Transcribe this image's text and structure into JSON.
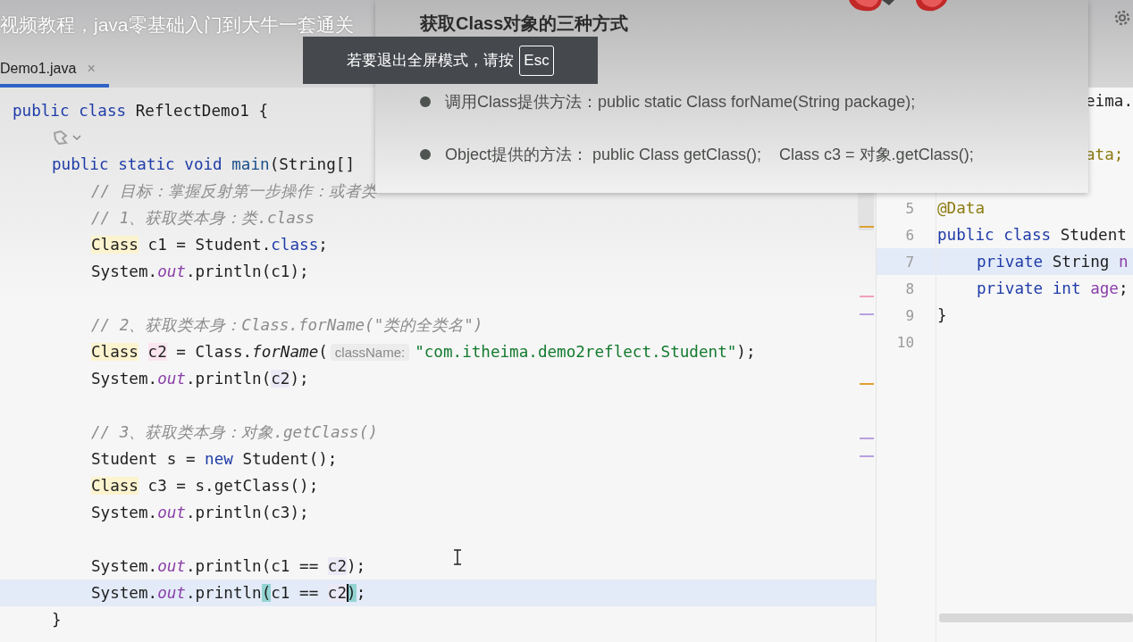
{
  "video_title": "视频教程，java零基础入门到大牛一套通关",
  "tab": {
    "label": "Demo1.java",
    "close": "×",
    "selected": true
  },
  "left_lines": [
    {
      "kind": "top",
      "current": false,
      "tokens": [
        {
          "kind": "kw",
          "text": "public class "
        },
        {
          "kind": "plain",
          "text": "ReflectDemo1 {"
        }
      ]
    },
    {
      "kind": "icon",
      "current": false
    },
    {
      "kind": "member",
      "current": false,
      "tokens": [
        {
          "kind": "kw",
          "text": "public static void "
        },
        {
          "kind": "method",
          "text": "main"
        },
        {
          "kind": "plain",
          "text": "(String[]"
        }
      ]
    },
    {
      "kind": "body",
      "current": false,
      "tokens": [
        {
          "kind": "comment",
          "text": "// 目标：掌握反射第一步操作：或者类"
        }
      ]
    },
    {
      "kind": "body",
      "current": false,
      "tokens": [
        {
          "kind": "comment",
          "text": "// 1、获取类本身：类.class"
        }
      ]
    },
    {
      "kind": "body",
      "current": false,
      "tokens": [
        {
          "kind": "type-hl",
          "text": "Class"
        },
        {
          "kind": "plain",
          "text": " c1 = Student."
        },
        {
          "kind": "kw",
          "text": "class"
        },
        {
          "kind": "plain",
          "text": ";"
        }
      ]
    },
    {
      "kind": "body",
      "current": false,
      "tokens": [
        {
          "kind": "plain",
          "text": "System."
        },
        {
          "kind": "field",
          "text": "out"
        },
        {
          "kind": "plain",
          "text": ".println(c1);"
        }
      ]
    },
    {
      "kind": "blank",
      "current": false
    },
    {
      "kind": "body",
      "current": false,
      "tokens": [
        {
          "kind": "comment",
          "text": "// 2、获取类本身：Class.forName(\"类的全类名\")"
        }
      ]
    },
    {
      "kind": "body",
      "current": false,
      "tokens": [
        {
          "kind": "type-hl",
          "text": "Class"
        },
        {
          "kind": "var-hl",
          "text": "c2"
        },
        {
          "kind": "plain",
          "text": " = Class."
        },
        {
          "kind": "static",
          "text": "forName"
        },
        {
          "kind": "plain",
          "text": "("
        },
        {
          "kind": "hint",
          "text": "className:"
        },
        {
          "kind": "string",
          "text": "\"com.itheima.demo2reflect.Student\""
        },
        {
          "kind": "plain",
          "text": ");"
        }
      ]
    },
    {
      "kind": "body",
      "current": false,
      "tokens": [
        {
          "kind": "plain",
          "text": "System."
        },
        {
          "kind": "field",
          "text": "out"
        },
        {
          "kind": "plain",
          "text": ".println("
        },
        {
          "kind": "ref-hl",
          "text": "c2"
        },
        {
          "kind": "plain",
          "text": ");"
        }
      ]
    },
    {
      "kind": "blank",
      "current": false
    },
    {
      "kind": "body",
      "current": false,
      "tokens": [
        {
          "kind": "comment",
          "text": "// 3、获取类本身：对象.getClass()"
        }
      ]
    },
    {
      "kind": "body",
      "current": false,
      "tokens": [
        {
          "kind": "plain",
          "text": "Student s = "
        },
        {
          "kind": "kw",
          "text": "new"
        },
        {
          "kind": "plain",
          "text": " Student();"
        }
      ]
    },
    {
      "kind": "body",
      "current": false,
      "tokens": [
        {
          "kind": "type-hl",
          "text": "Class"
        },
        {
          "kind": "plain",
          "text": " c3 = s.getClass();"
        }
      ]
    },
    {
      "kind": "body",
      "current": false,
      "tokens": [
        {
          "kind": "plain",
          "text": "System."
        },
        {
          "kind": "field",
          "text": "out"
        },
        {
          "kind": "plain",
          "text": ".println(c3);"
        }
      ]
    },
    {
      "kind": "blank",
      "current": false
    },
    {
      "kind": "body",
      "current": false,
      "tokens": [
        {
          "kind": "plain",
          "text": "System."
        },
        {
          "kind": "field",
          "text": "out"
        },
        {
          "kind": "plain",
          "text": ".println(c1 == "
        },
        {
          "kind": "ref-hl",
          "text": "c2"
        },
        {
          "kind": "plain",
          "text": ");"
        }
      ]
    },
    {
      "kind": "body",
      "current": true,
      "tokens": [
        {
          "kind": "plain",
          "text": "System."
        },
        {
          "kind": "field",
          "text": "out"
        },
        {
          "kind": "plain",
          "text": ".println"
        },
        {
          "kind": "brace-hl",
          "text": "("
        },
        {
          "kind": "plain",
          "text": "c1 == "
        },
        {
          "kind": "ref-hl",
          "text": "c2"
        },
        {
          "kind": "brace-caret",
          "text": ")"
        },
        {
          "kind": "plain",
          "text": ";"
        }
      ]
    },
    {
      "kind": "member",
      "current": false,
      "tokens": [
        {
          "kind": "plain",
          "text": "}"
        }
      ]
    }
  ],
  "right_lines": [
    {
      "kind": "partial",
      "current": false,
      "tokens": [
        {
          "kind": "plain",
          "text": "eima."
        }
      ]
    },
    {
      "kind": "blank",
      "current": false
    },
    {
      "kind": "partial",
      "current": false,
      "tokens": [
        {
          "kind": "annot",
          "text": "ata;"
        }
      ]
    },
    {
      "kind": "blank",
      "current": false
    },
    {
      "kind": "top",
      "number": "5",
      "current": false,
      "tokens": [
        {
          "kind": "annot",
          "text": "@Data"
        }
      ]
    },
    {
      "kind": "top",
      "number": "6",
      "current": false,
      "tokens": [
        {
          "kind": "kw",
          "text": "public class "
        },
        {
          "kind": "plain",
          "text": "Student"
        }
      ]
    },
    {
      "kind": "member",
      "number": "7",
      "current": true,
      "tokens": [
        {
          "kind": "kw",
          "text": "private "
        },
        {
          "kind": "plain",
          "text": "String "
        },
        {
          "kind": "field-plain",
          "text": "n"
        }
      ]
    },
    {
      "kind": "member",
      "number": "8",
      "current": false,
      "tokens": [
        {
          "kind": "kw",
          "text": "private int "
        },
        {
          "kind": "field-plain",
          "text": "age"
        },
        {
          "kind": "plain",
          "text": ";"
        }
      ]
    },
    {
      "kind": "top",
      "number": "9",
      "current": false,
      "tokens": [
        {
          "kind": "plain",
          "text": "}"
        }
      ]
    },
    {
      "kind": "blank",
      "number": "10",
      "current": false
    }
  ],
  "slide": {
    "title": "获取Class对象的三种方式",
    "bullets": [
      "调用Class提供方法：public static Class forName(String package);",
      "Object提供的方法： public Class getClass();    Class c3 = 对象.getClass();"
    ]
  },
  "fullscreen_toast": {
    "message": "若要退出全屏模式，请按",
    "key": "Esc"
  }
}
